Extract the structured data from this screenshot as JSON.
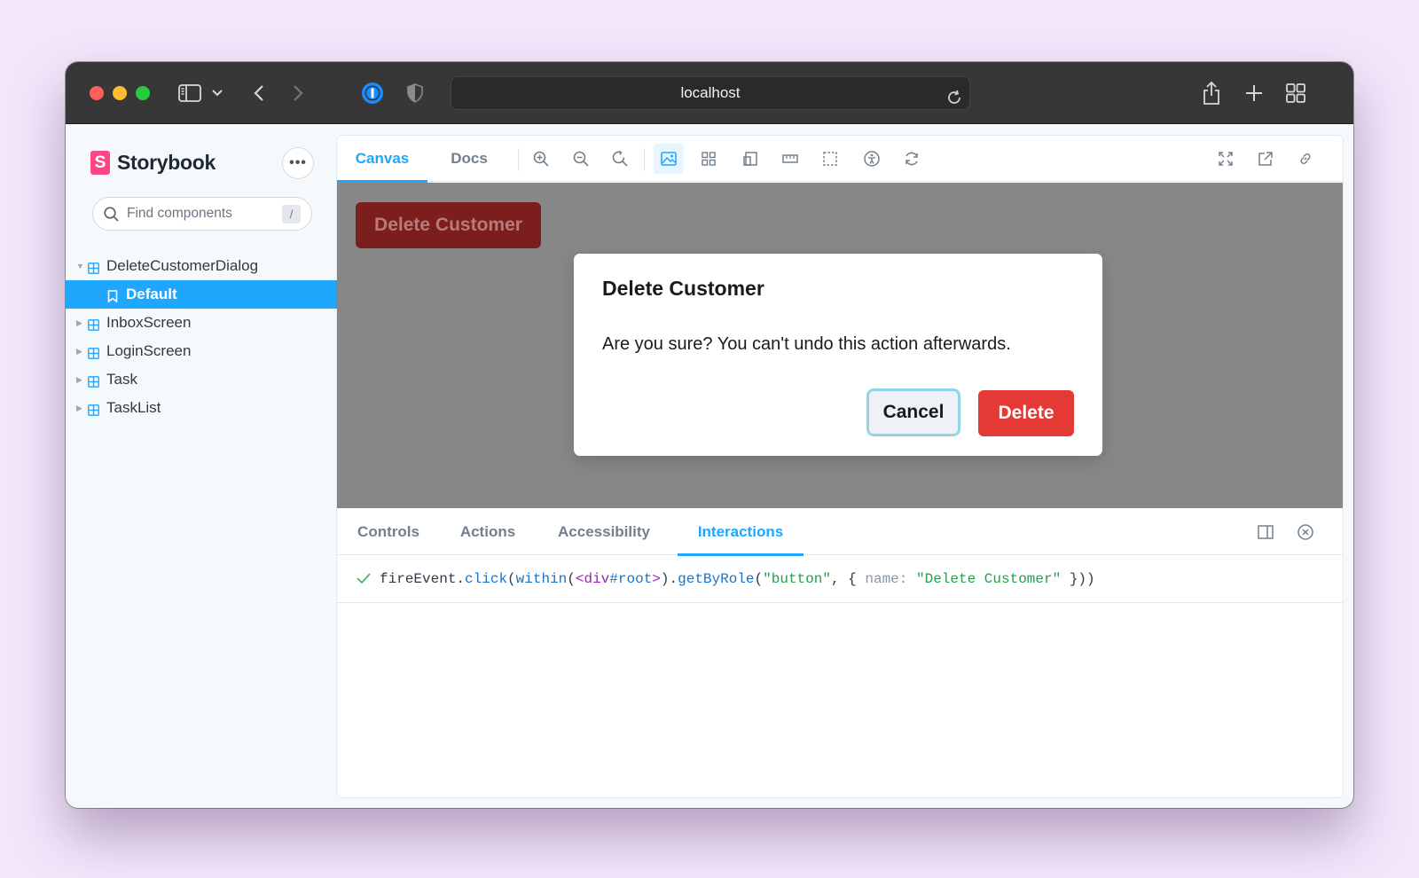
{
  "browser": {
    "url": "localhost"
  },
  "sidebar": {
    "brand": "Storybook",
    "brand_logo": "S",
    "more_label": "•••",
    "search": {
      "placeholder": "Find components",
      "shortcut": "/"
    },
    "tree": [
      {
        "label": "DeleteCustomerDialog",
        "expanded": true
      },
      {
        "label": "Default",
        "selected": true
      },
      {
        "label": "InboxScreen"
      },
      {
        "label": "LoginScreen"
      },
      {
        "label": "Task"
      },
      {
        "label": "TaskList"
      }
    ]
  },
  "toolbar": {
    "tabs": [
      "Canvas",
      "Docs"
    ],
    "active_tab": "Canvas",
    "icons": [
      "zoom-in-icon",
      "zoom-out-icon",
      "zoom-reset-icon",
      "background-icon",
      "grid-icon",
      "viewport-icon",
      "measure-icon",
      "outline-icon",
      "accessibility-icon",
      "remount-icon",
      "fullscreen-icon",
      "open-new-tab-icon",
      "copy-link-icon"
    ]
  },
  "canvas": {
    "trigger_button": "Delete Customer",
    "dialog": {
      "title": "Delete Customer",
      "body": "Are you sure? You can't undo this action afterwards.",
      "cancel_label": "Cancel",
      "delete_label": "Delete"
    }
  },
  "panel": {
    "tabs": [
      "Controls",
      "Actions",
      "Accessibility",
      "Interactions"
    ],
    "active_tab": "Interactions",
    "interaction": {
      "status": "pass",
      "t1": "fireEvent",
      "t2": ".",
      "t3": "click",
      "t4": "(",
      "t5": "within",
      "t6": "(",
      "t7": "<div",
      "t8": "#root",
      "t9": ">",
      "t10": ").",
      "t11": "getByRole",
      "t12": "(",
      "t13": "\"button\"",
      "t14": ", { ",
      "t15": "name:",
      "t16": " ",
      "t17": "\"Delete Customer\"",
      "t18": " }))"
    }
  },
  "colors": {
    "accent": "#1ea7fd",
    "brand": "#ff4785",
    "danger": "#e53935",
    "success": "#47b869"
  }
}
